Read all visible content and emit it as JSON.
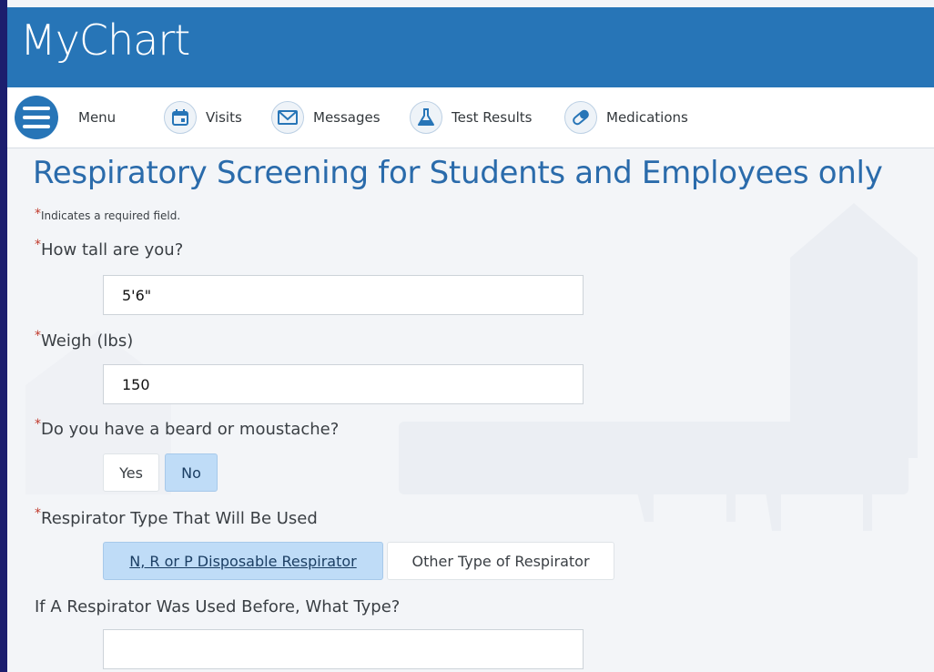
{
  "header": {
    "logo_text": "MyChart"
  },
  "nav": {
    "items": [
      {
        "label": "Menu",
        "icon": "hamburger-menu-icon"
      },
      {
        "label": "Visits",
        "icon": "calendar-icon"
      },
      {
        "label": "Messages",
        "icon": "envelope-icon"
      },
      {
        "label": "Test Results",
        "icon": "flask-icon"
      },
      {
        "label": "Medications",
        "icon": "pill-icon"
      }
    ]
  },
  "form": {
    "title": "Respiratory Screening for Students and Employees only",
    "required_note": "Indicates a required field.",
    "required_mark": "*",
    "height": {
      "label": "How tall are you?",
      "value": "5'6\""
    },
    "weight": {
      "label": "Weigh (lbs)",
      "value": "150"
    },
    "beard": {
      "label": "Do you have a beard or moustache?",
      "options": [
        "Yes",
        "No"
      ],
      "selected": "No"
    },
    "respirator_type": {
      "label": "Respirator Type That Will Be Used",
      "options": [
        "N, R or P Disposable Respirator",
        "Other Type of Respirator"
      ],
      "selected": "N, R or P Disposable Respirator"
    },
    "previous_type": {
      "label": "If A Respirator Was Used Before, What Type?",
      "value": ""
    }
  },
  "colors": {
    "brand_blue": "#2775b7",
    "title_blue": "#2a6bab",
    "selected_bg": "#bfdcf7",
    "required_red": "#c0392b"
  }
}
